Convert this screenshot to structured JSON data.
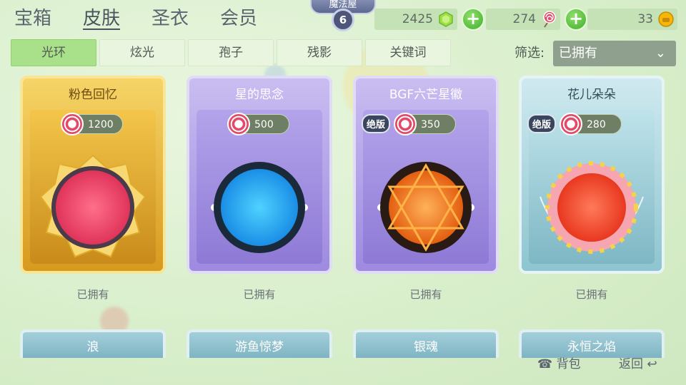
{
  "topnav": {
    "tabs": [
      "宝箱",
      "皮肤",
      "圣衣",
      "会员"
    ],
    "active_index": 1
  },
  "level_badge": {
    "title": "魔法屋",
    "level": "6"
  },
  "currency": {
    "gems": "2425",
    "candy": "274",
    "gold": "33",
    "colors": {
      "gem": "#9be04a",
      "candy": "#e14a68",
      "gold": "#f5b80a"
    }
  },
  "subtabs": {
    "items": [
      "光环",
      "炫光",
      "孢子",
      "残影",
      "关键词"
    ],
    "active_index": 0
  },
  "filter": {
    "label": "筛选:",
    "value": "已拥有"
  },
  "cards": [
    {
      "title": "粉色回忆",
      "price": "1200",
      "limited": "",
      "status": "已拥有",
      "theme": "gold",
      "orb_color": "#ff5a78"
    },
    {
      "title": "星的思念",
      "price": "500",
      "limited": "",
      "status": "已拥有",
      "theme": "purple",
      "orb_color": "#2fb6ff"
    },
    {
      "title": "BGF六芒星徽",
      "price": "350",
      "limited": "绝版",
      "status": "已拥有",
      "theme": "purple",
      "orb_color": "#ff8a1f"
    },
    {
      "title": "花儿朵朵",
      "price": "280",
      "limited": "绝版",
      "status": "已拥有",
      "theme": "teal",
      "orb_color": "#ff5a3c"
    }
  ],
  "cards_row2": [
    "浪",
    "游鱼惊梦",
    "银魂",
    "永恒之焰"
  ],
  "bottom": {
    "bag_label": "背包",
    "back_label": "返回"
  }
}
